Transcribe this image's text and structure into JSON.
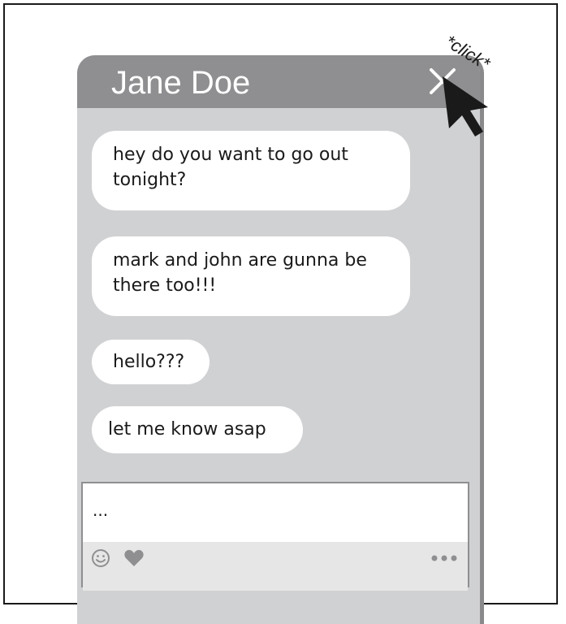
{
  "chat": {
    "contact_name": "Jane Doe",
    "close_icon": "close-icon",
    "messages": [
      {
        "text": "hey do you want to go out tonight?"
      },
      {
        "text": "mark and john are gunna be there too!!!"
      },
      {
        "text": "hello???"
      },
      {
        "text": "let me know asap"
      }
    ],
    "composer": {
      "value": "...",
      "icons": [
        "smiley-icon",
        "heart-icon",
        "more-dots-icon"
      ]
    }
  },
  "annotation": {
    "click_label": "*click*",
    "cursor_icon": "mouse-cursor-icon"
  },
  "colors": {
    "header": "#8f8f91",
    "panel": "#d0d1d3",
    "bubble": "#ffffff",
    "toolbar": "#e6e6e7",
    "ink": "#1a1a1a"
  }
}
